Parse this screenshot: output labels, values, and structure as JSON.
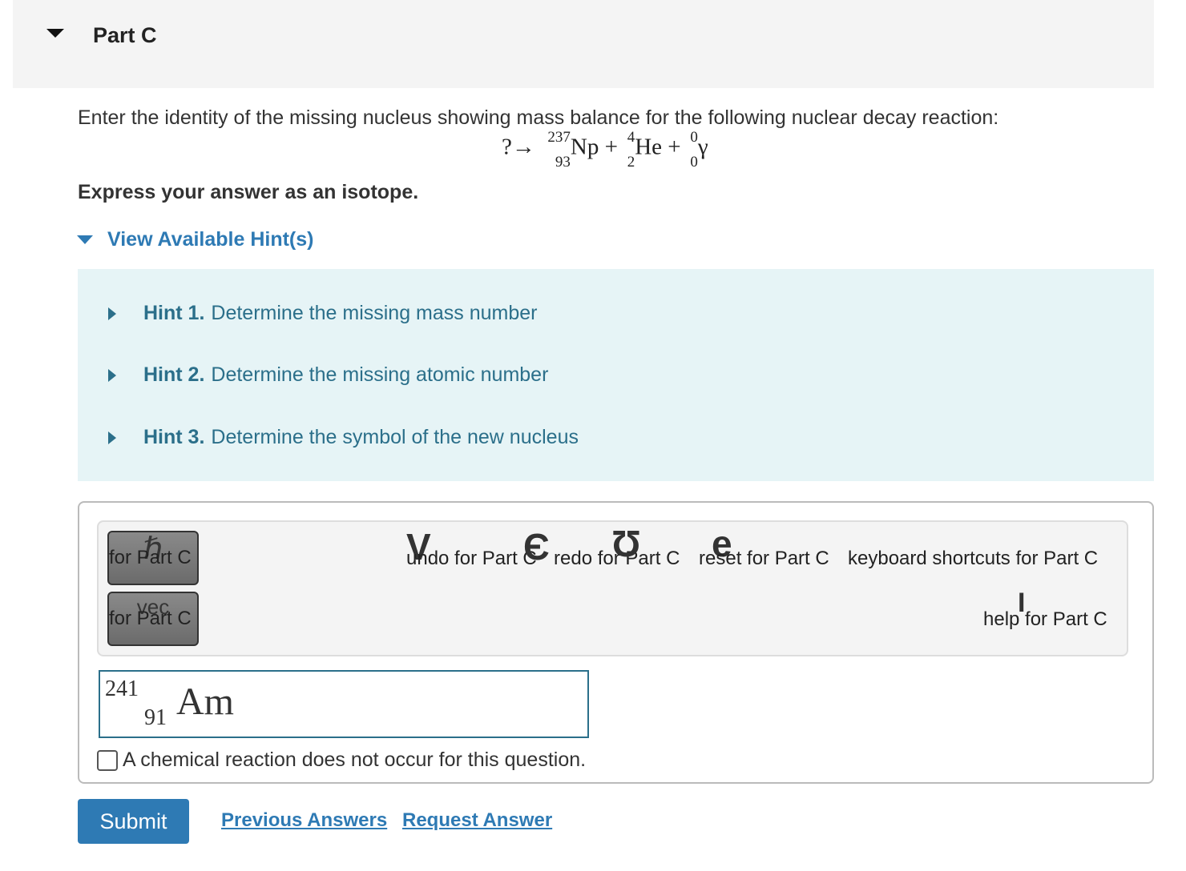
{
  "part": {
    "title": "Part C"
  },
  "question": {
    "text": "Enter the identity of the missing nucleus showing mass balance for the following nuclear decay reaction:",
    "equation": {
      "lhs": "?",
      "arrow": "→",
      "plus": "+",
      "products": [
        {
          "mass": "237",
          "atomic": "93",
          "symbol": "Np"
        },
        {
          "mass": "4",
          "atomic": "2",
          "symbol": "He"
        },
        {
          "mass": "0",
          "atomic": "0",
          "symbol": "γ"
        }
      ]
    },
    "instructions": "Express your answer as an isotope."
  },
  "hints": {
    "toggle_label": "View Available Hint(s)",
    "items": [
      {
        "number": "Hint 1.",
        "text": "Determine the missing mass number"
      },
      {
        "number": "Hint 2.",
        "text": "Determine the missing atomic number"
      },
      {
        "number": "Hint 3.",
        "text": "Determine the symbol of the new nucleus"
      }
    ]
  },
  "toolbar": {
    "templates_label": "for Part C",
    "vector_label": "for Part C",
    "undo_label": "undo for Part C",
    "redo_label": "redo for Part C",
    "reset_label": "reset for Part C",
    "shortcuts_label": "keyboard shortcuts for Part C",
    "help_label": "help for Part C",
    "icons": [
      "templates-icon",
      "vector-icon",
      "undo-icon",
      "redo-icon",
      "reset-icon",
      "help-icon"
    ]
  },
  "answer": {
    "mass": "241",
    "atomic": "91",
    "symbol": "Am"
  },
  "no_reaction_label": "A chemical reaction does not occur for this question.",
  "actions": {
    "submit": "Submit",
    "previous_answers": "Previous Answers",
    "request_answer": "Request Answer"
  },
  "colors": {
    "accent": "#2e7ab4",
    "hint_bg": "#e6f4f6",
    "hint_text": "#2b6f8a"
  }
}
